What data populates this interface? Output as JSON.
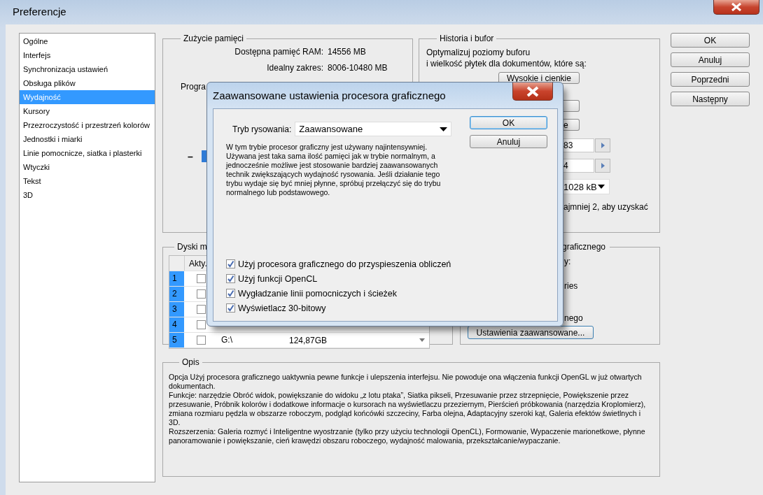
{
  "window": {
    "title": "Preferencje"
  },
  "sidebar": {
    "items": [
      {
        "label": "Ogólne",
        "selected": false
      },
      {
        "label": "Interfejs",
        "selected": false
      },
      {
        "label": "Synchronizacja ustawień",
        "selected": false
      },
      {
        "label": "Obsługa plików",
        "selected": false
      },
      {
        "label": "Wydajność",
        "selected": true
      },
      {
        "label": "Kursory",
        "selected": false
      },
      {
        "label": "Przezroczystość i przestrzeń kolorów",
        "selected": false
      },
      {
        "label": "Jednostki i miarki",
        "selected": false
      },
      {
        "label": "Linie pomocnicze, siatka i plasterki",
        "selected": false
      },
      {
        "label": "Wtyczki",
        "selected": false
      },
      {
        "label": "Tekst",
        "selected": false
      },
      {
        "label": "3D",
        "selected": false
      }
    ]
  },
  "memory": {
    "title": "Zużycie pamięci",
    "rows": [
      {
        "label": "Dostępna pamięć RAM:",
        "value": "14556 MB"
      },
      {
        "label": "Idealny zakres:",
        "value": "8006-10480 MB"
      }
    ],
    "program_label": "Progra",
    "slider_minus": "–"
  },
  "history": {
    "title": "Historia i bufor",
    "description": "Optymalizuj poziomy buforu\ni wielkość płytek dla dokumentów, które są:",
    "preset_button": "Wysokie i cienkie",
    "preset_button_3": "e",
    "field_1": "83",
    "field_2": "4",
    "tile_size": "1028 kB",
    "note": "ajmniej 2, aby uzyskać"
  },
  "disks": {
    "title": "Dyski m",
    "header": "Akty.",
    "rows": [
      {
        "number": "1",
        "active": false
      },
      {
        "number": "2",
        "active": false
      },
      {
        "number": "3",
        "active": false
      },
      {
        "number": "4",
        "active": false
      },
      {
        "number": "5",
        "active": false,
        "path": "G:\\",
        "size": "124,87GB"
      }
    ]
  },
  "gpu": {
    "title": "graficznego",
    "lines": [
      "y:",
      "ries",
      "nego"
    ],
    "advanced_button": "Ustawienia zaawansowane..."
  },
  "description": {
    "title": "Opis",
    "paragraphs": [
      "Opcja Użyj procesora graficznego uaktywnia pewne funkcje i ulepszenia interfejsu. Nie powoduje ona włączenia funkcji OpenGL w już otwartych dokumentach.",
      "Funkcje: narzędzie Obróć widok, powiększanie do widoku „z lotu ptaka”, Siatka pikseli, Przesuwanie przez strzepnięcie, Powiększenie przez przesuwanie, Próbnik kolorów i dodatkowe informacje o kursorach na wyświetlaczu przeziernym, Pierścień próbkowania (narzędzia Kroplomierz), zmiana rozmiaru pędzla w obszarze roboczym, podgląd końcówki szczeciny, Farba olejna, Adaptacyjny szeroki kąt, Galeria efektów świetlnych i 3D.",
      "Rozszerzenia: Galeria rozmyć i Inteligentne wyostrzanie (tylko przy użyciu technologii OpenCL), Formowanie, Wypaczenie marionetkowe, płynne panoramowanie i powiększanie, cień krawędzi obszaru roboczego, wydajność malowania, przekształcanie/wypaczanie."
    ]
  },
  "buttons": [
    {
      "label": "OK",
      "default": false
    },
    {
      "label": "Anuluj",
      "default": false
    },
    {
      "label": "Poprzedni",
      "default": false
    },
    {
      "label": "Następny",
      "default": false
    }
  ],
  "dialog": {
    "title": "Zaawansowane ustawienia procesora graficznego",
    "mode_label": "Tryb rysowania:",
    "mode_value": "Zaawansowane",
    "description": "W tym trybie procesor graficzny jest używany najintensywniej. Używana jest taka sama ilość pamięci jak w trybie normalnym, a jednocześnie możliwe jest stosowanie bardziej zaawansowanych technik zwiększających wydajność rysowania. Jeśli działanie tego trybu wydaje się być mniej płynne, spróbuj przełączyć się do trybu normalnego lub podstawowego.",
    "buttons": [
      {
        "label": "OK",
        "default": true
      },
      {
        "label": "Anuluj",
        "default": false
      }
    ],
    "options": [
      {
        "label": "Użyj procesora graficznego do przyspieszenia obliczeń",
        "checked": true
      },
      {
        "label": "Użyj funkcji OpenCL",
        "checked": true
      },
      {
        "label": "Wygładzanie linii pomocniczych i ścieżek",
        "checked": true
      },
      {
        "label": "Wyświetlacz 30-bitowy",
        "checked": true
      }
    ]
  }
}
